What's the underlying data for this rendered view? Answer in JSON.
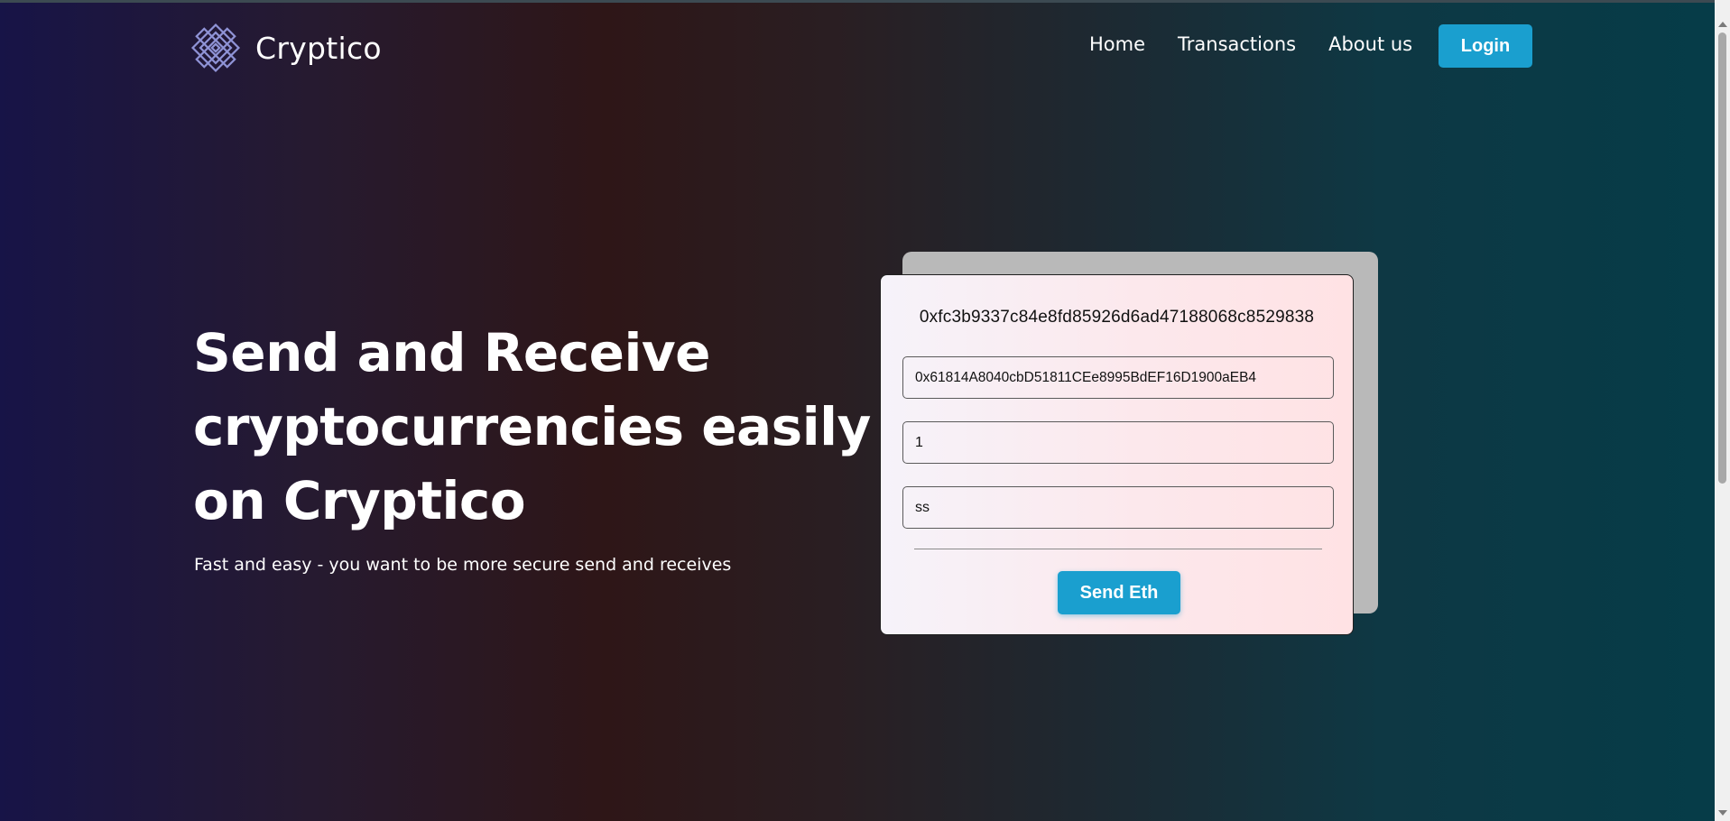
{
  "brand": {
    "name": "Cryptico",
    "logo_icon": "knot-icon"
  },
  "nav": {
    "items": [
      {
        "label": "Home"
      },
      {
        "label": "Transactions"
      },
      {
        "label": "About us"
      }
    ],
    "login_label": "Login"
  },
  "hero": {
    "title": "Send and Receive cryptocurrencies easily on Cryptico",
    "subtitle": "Fast and easy - you want to be more secure send and receives"
  },
  "form": {
    "wallet_address": "0xfc3b9337c84e8fd85926d6ad47188068c8529838",
    "address_to": "0x61814A8040cbD51811CEe8995BdEF16D1900aEB4",
    "amount": "1",
    "message": "ss",
    "submit_label": "Send Eth"
  },
  "colors": {
    "accent": "#1a9fcf",
    "card_shadow": "#b9b9b9"
  }
}
